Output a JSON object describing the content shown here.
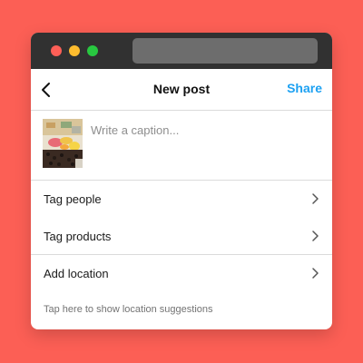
{
  "header": {
    "title": "New post",
    "share_label": "Share",
    "back_icon": "chevron-left-icon",
    "accent_color": "#1da1f2"
  },
  "caption": {
    "placeholder": "Write a caption..."
  },
  "options": [
    {
      "label": "Tag people",
      "icon": "chevron-right-icon"
    },
    {
      "label": "Tag products",
      "icon": "chevron-right-icon"
    },
    {
      "label": "Add location",
      "icon": "chevron-right-icon"
    }
  ],
  "location_hint": "Tap here to show location suggestions",
  "colors": {
    "background": "#fc5f55",
    "titlebar": "#313131",
    "divider": "#dbdbdb"
  }
}
